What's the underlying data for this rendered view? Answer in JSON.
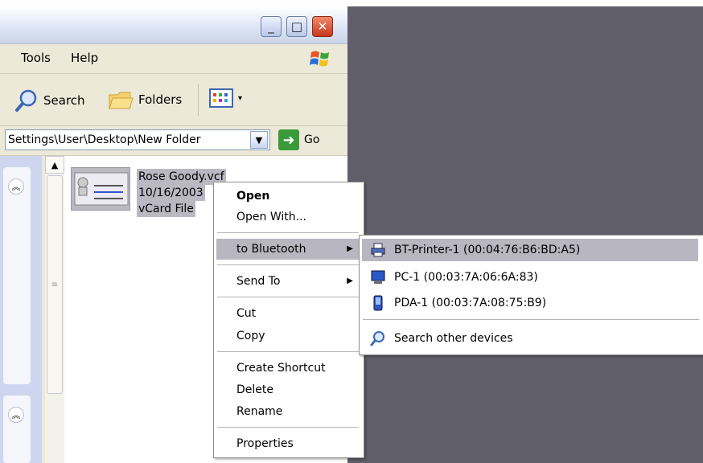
{
  "window": {
    "buttons": {
      "minimize": "_",
      "maximize": "□",
      "close": "✕"
    }
  },
  "menubar": {
    "items": [
      "Tools",
      "Help"
    ]
  },
  "toolbar": {
    "search_label": "Search",
    "folders_label": "Folders"
  },
  "address": {
    "path": "Settings\\User\\Desktop\\New Folder",
    "go_label": "Go"
  },
  "file": {
    "name": "Rose Goody.vcf",
    "date": "10/16/2003",
    "type": "vCard File"
  },
  "context_menu": {
    "open": "Open",
    "open_with": "Open With...",
    "to_bluetooth": "to Bluetooth",
    "send_to": "Send To",
    "cut": "Cut",
    "copy": "Copy",
    "create_shortcut": "Create Shortcut",
    "delete": "Delete",
    "rename": "Rename",
    "properties": "Properties"
  },
  "bluetooth_submenu": {
    "devices": [
      {
        "label": "BT-Printer-1 (00:04:76:B6:BD:A5)",
        "icon": "printer-icon"
      },
      {
        "label": "PC-1 (00:03:7A:06:6A:83)",
        "icon": "computer-icon"
      },
      {
        "label": "PDA-1 (00:03:7A:08:75:B9)",
        "icon": "pda-icon"
      }
    ],
    "search_other": "Search other devices"
  },
  "colors": {
    "desktop": "#5f5e69",
    "highlight": "#b7b6c1",
    "menu_bg": "#ffffff"
  }
}
